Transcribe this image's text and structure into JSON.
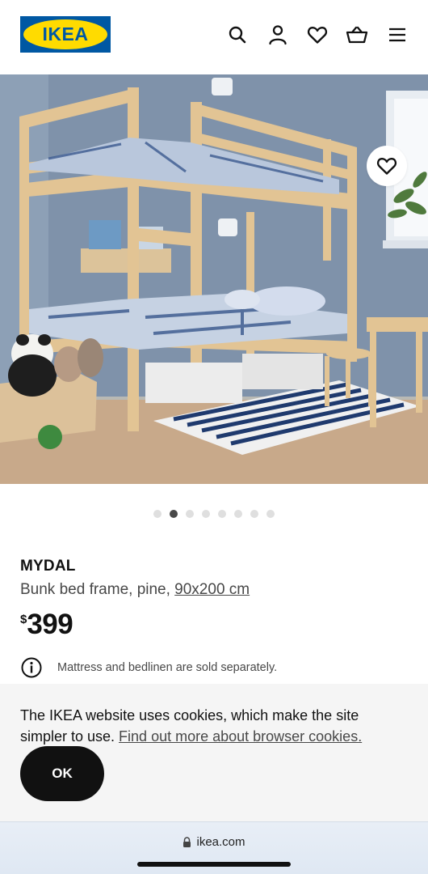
{
  "header": {
    "logo_text": "IKEA",
    "icons": [
      "search-icon",
      "user-icon",
      "heart-icon",
      "basket-icon",
      "menu-icon"
    ]
  },
  "hero": {
    "favorite_icon": "heart-icon",
    "carousel": {
      "total": 8,
      "active_index": 1
    }
  },
  "product": {
    "name": "MYDAL",
    "description_prefix": "Bunk bed frame, pine, ",
    "size": "90x200 cm",
    "currency": "$",
    "price": "399",
    "notice_icon": "info-icon",
    "notice": "Mattress and bedlinen are sold separately."
  },
  "cookie": {
    "text": "The IKEA website uses cookies, which make the site simpler to use. ",
    "link": "Find out more about browser cookies.",
    "ok_label": "OK"
  },
  "browser": {
    "url": "ikea.com",
    "lock_icon": "lock-icon"
  },
  "colors": {
    "brand_blue": "#0058a3",
    "brand_yellow": "#ffdb00",
    "text": "#111111",
    "secondary_text": "#484848",
    "cookie_bg": "#f5f5f5"
  }
}
